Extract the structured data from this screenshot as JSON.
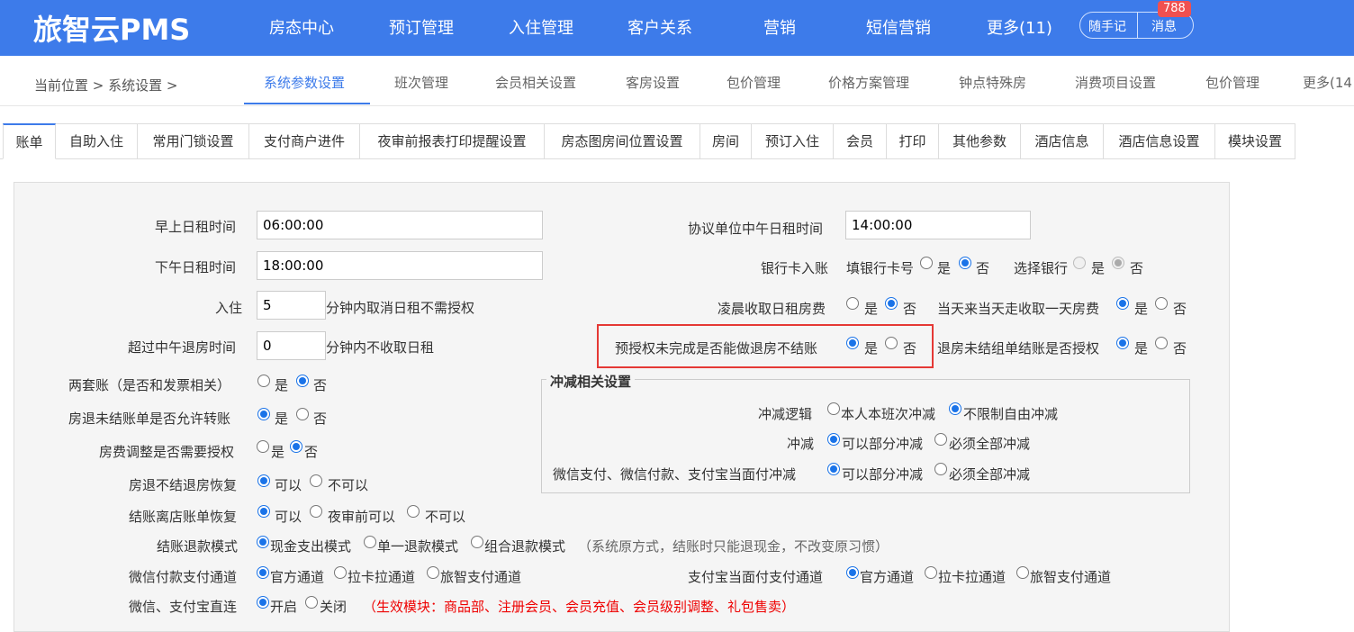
{
  "app": {
    "logo": "旅智云PMS"
  },
  "topnav": [
    "房态中心",
    "预订管理",
    "入住管理",
    "客户关系",
    "营销",
    "短信营销",
    "更多(11)"
  ],
  "topright": {
    "note": "随手记",
    "message": "消息",
    "badge": "788"
  },
  "breadcrumb": "当前位置 > 系统设置 >",
  "subtabs": [
    "系统参数设置",
    "班次管理",
    "会员相关设置",
    "客房设置",
    "包价管理",
    "价格方案管理",
    "钟点特殊房",
    "消费项目设置",
    "包价管理",
    "更多(14"
  ],
  "tabs": [
    "账单",
    "自助入住",
    "常用门锁设置",
    "支付商户进件",
    "夜审前报表打印提醒设置",
    "房态图房间位置设置",
    "房间",
    "预订入住",
    "会员",
    "打印",
    "其他参数",
    "酒店信息",
    "酒店信息设置",
    "模块设置"
  ],
  "form": {
    "morning_label": "早上日租时间",
    "morning_value": "06:00:00",
    "afternoon_label": "下午日租时间",
    "afternoon_value": "18:00:00",
    "checkin_label": "入住",
    "checkin_value": "5",
    "checkin_suffix": "分钟内取消日租不需授权",
    "noon_label": "超过中午退房时间",
    "noon_value": "0",
    "noon_suffix": "分钟内不收取日租",
    "two_acct_label": "两套账（是否和发票相关）",
    "transfer_label": "房退未结账单是否允许转账",
    "adjust_label": "房费调整是否需要授权",
    "restore_label": "房退不结退房恢复",
    "leave_label": "结账离店账单恢复",
    "refund_label": "结账退款模式",
    "wechat_label": "微信付款支付通道",
    "direct_label": "微信、支付宝直连",
    "yes": "是",
    "no": "否",
    "can": "可以",
    "cannot": "不可以",
    "before_audit": "夜审前可以",
    "refund_opts": [
      "现金支出模式",
      "单一退款模式",
      "组合退款模式"
    ],
    "refund_note": "（系统原方式，结账时只能退现金，不改变原习惯）",
    "channel_opts": [
      "官方通道",
      "拉卡拉通道",
      "旅智支付通道"
    ],
    "direct_opts": [
      "开启",
      "关闭"
    ],
    "direct_note": "（生效模块：商品部、注册会员、会员充值、会员级别调整、礼包售卖）",
    "agreement_label": "协议单位中午日租时间",
    "agreement_value": "14:00:00",
    "bankcard_label": "银行卡入账",
    "bankcard_fill": "填银行卡号",
    "bankcard_choose": "选择银行",
    "early_label": "凌晨收取日租房费",
    "sameday_label": "当天来当天走收取一天房费",
    "preauth_label": "预授权未完成是否能做退房不结账",
    "group_label": "退房未结组单结账是否授权",
    "alipay_label": "支付宝当面付支付通道"
  },
  "offset": {
    "legend": "冲减相关设置",
    "logic_label": "冲减逻辑",
    "logic_opts": [
      "本人本班次冲减",
      "不限制自由冲减"
    ],
    "offset_label": "冲减",
    "offset_opts": [
      "可以部分冲减",
      "必须全部冲减"
    ],
    "pay_label": "微信支付、微信付款、支付宝当面付冲减",
    "pay_opts": [
      "可以部分冲减",
      "必须全部冲减"
    ]
  }
}
